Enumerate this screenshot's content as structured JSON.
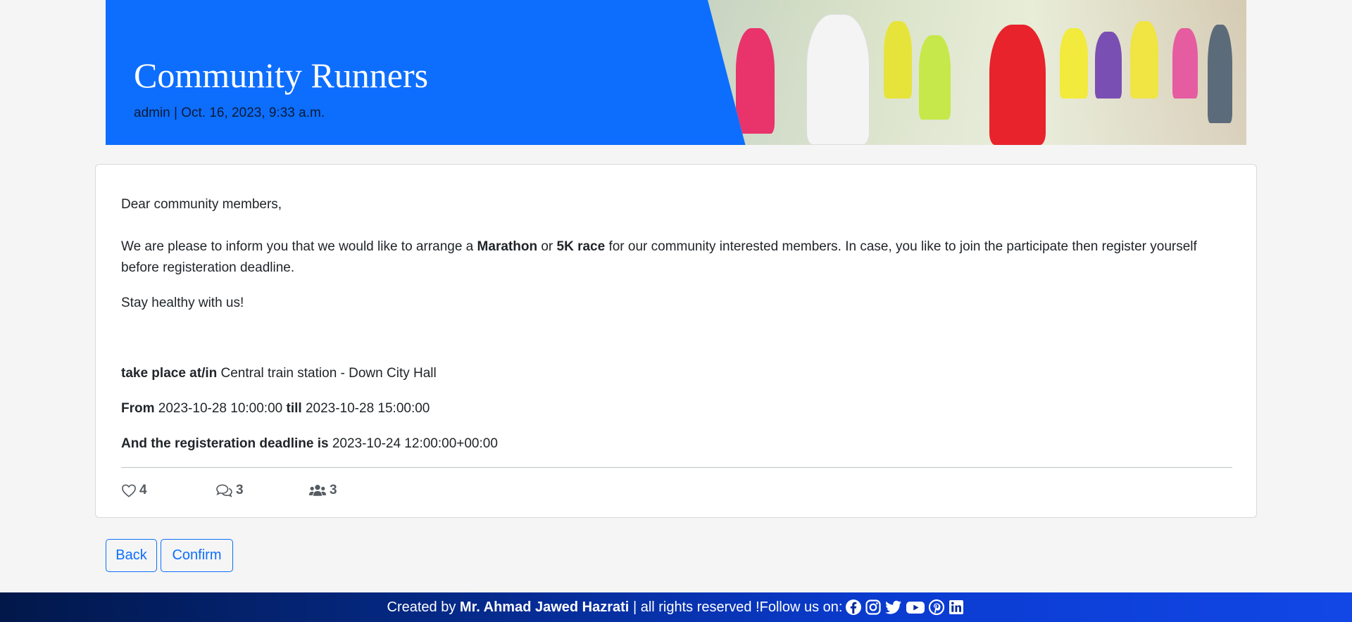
{
  "header": {
    "title": "Community Runners",
    "author": "admin",
    "separator": "|",
    "date": "Oct. 16, 2023, 9:33 a.m."
  },
  "post": {
    "greeting": "Dear community members,",
    "intro_before": "We are please to inform you that we would like to arrange a ",
    "intro_bold1": "Marathon",
    "intro_mid": " or ",
    "intro_bold2": "5K race",
    "intro_after": " for our community interested members. In case, you like to join the participate then register yourself before registeration deadline.",
    "stay": "Stay healthy with us!",
    "place_label": "take place at/in",
    "place_value": " Central train station - Down City Hall",
    "from_label": "From",
    "from_value": " 2023-10-28 10:00:00 ",
    "till_label": "till",
    "till_value": " 2023-10-28 15:00:00",
    "deadline_label": "And the registeration deadline is",
    "deadline_value": " 2023-10-24 12:00:00+00:00"
  },
  "stats": {
    "likes": "4",
    "comments": "3",
    "participants": "3",
    "icons": [
      "heart-icon",
      "comments-icon",
      "users-icon"
    ]
  },
  "actions": {
    "back_label": "Back",
    "confirm_label": "Confirm"
  },
  "footer": {
    "prefix": "Created by ",
    "author": "Mr. Ahmad Jawed Hazrati",
    "suffix": " | all rights reserved !Follow us on: ",
    "social_icons": [
      "facebook-icon",
      "instagram-icon",
      "twitter-icon",
      "youtube-icon",
      "pinterest-icon",
      "linkedin-icon"
    ]
  },
  "colors": {
    "primary": "#0d6efd",
    "background": "#f5f5f5",
    "footer_start": "#02184a",
    "footer_end": "#1247e6"
  }
}
